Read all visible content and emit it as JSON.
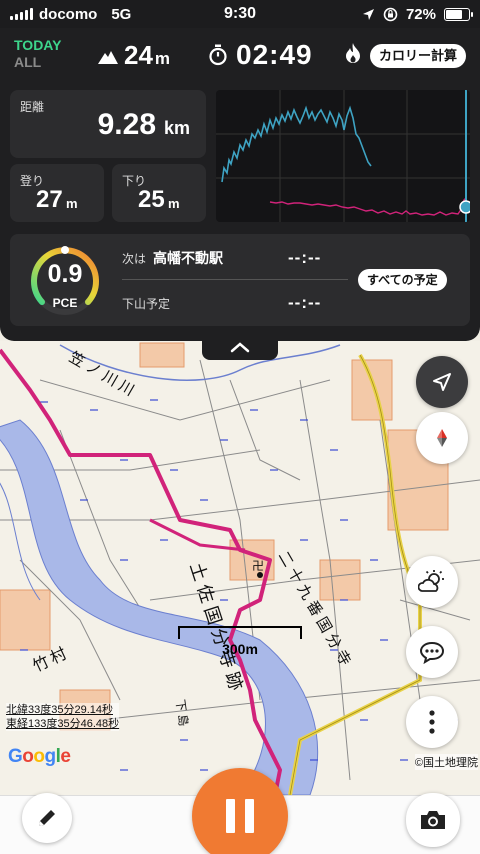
{
  "status_bar": {
    "carrier": "docomo",
    "network": "5G",
    "time": "9:30",
    "battery": "72%",
    "battery_level": 0.72
  },
  "header": {
    "today_label": "TODAY",
    "all_label": "ALL",
    "elevation_value": "24",
    "elevation_unit": "m",
    "timer_value": "02:49",
    "calorie_button": "カロリー計算"
  },
  "stats": {
    "distance_label": "距離",
    "distance_value": "9.28",
    "distance_unit": "km",
    "ascent_label": "登り",
    "ascent_value": "27",
    "ascent_unit": "m",
    "descent_label": "下り",
    "descent_value": "25",
    "descent_unit": "m"
  },
  "plan": {
    "pce_value": "0.9",
    "pce_label": "PCE",
    "next_prefix": "次は",
    "next_name": "高幡不動駅",
    "next_time": "--:--",
    "destination_label": "下山予定",
    "destination_time": "--:--",
    "all_plans_button": "すべての予定"
  },
  "map": {
    "scale_label": "300m",
    "lat": "北緯33度35分29.14秒",
    "lon": "東経133度35分46.48秒",
    "google": "Google",
    "attribution": "©国土地理院",
    "labels": {
      "river_name": "笠ノ川川",
      "site_name": "土佐国分寺跡",
      "temple_name": "二十九番国分寺",
      "place_left": "竹村",
      "place_bottom": "下島"
    }
  },
  "colors": {
    "accent_orange": "#f07a32",
    "today_green": "#3dd68c",
    "track_pink": "#d1237a",
    "elevation_line": "#3ea3c3"
  },
  "icons": [
    "mountain-icon",
    "stopwatch-icon",
    "flame-icon",
    "location-arrow-icon",
    "compass-icon",
    "weather-icon",
    "chat-icon",
    "more-icon",
    "pencil-icon",
    "pause-icon",
    "camera-icon",
    "chevron-up-icon"
  ]
}
